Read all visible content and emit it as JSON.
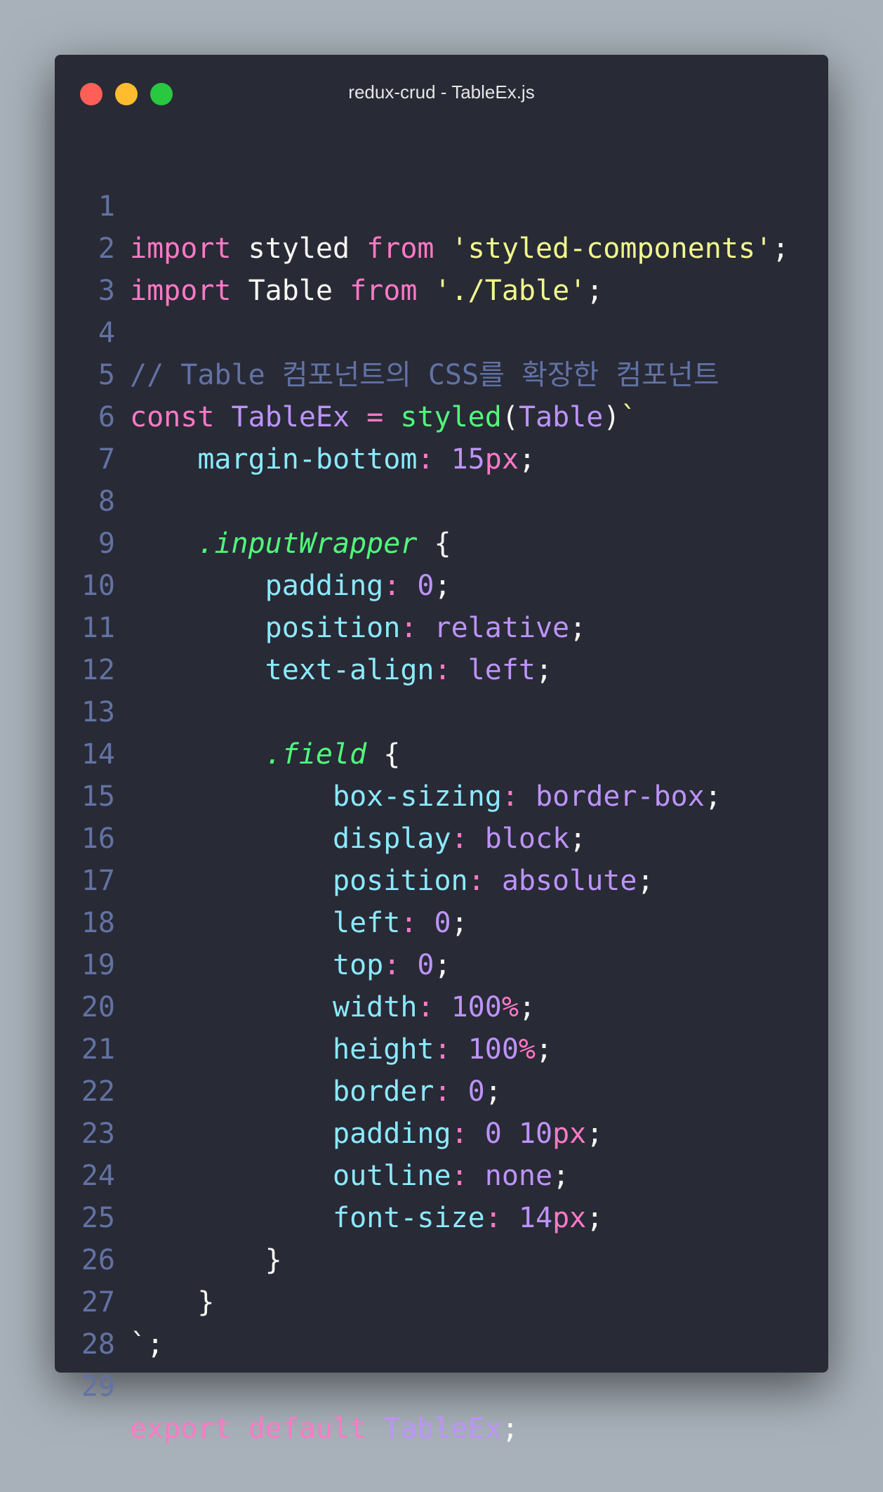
{
  "window": {
    "title": "redux-crud - TableEx.js"
  },
  "colors": {
    "background": "#a8b1ba",
    "editor": "#282a36",
    "close": "#ff5f57",
    "minimize": "#febc2e",
    "maximize": "#28c840",
    "keyword": "#ff79c6",
    "string": "#f1fa8c",
    "comment": "#6272a4",
    "function": "#50fa7b",
    "property": "#8be9fd",
    "value": "#bd93f9"
  },
  "code": {
    "line_numbers": [
      "1",
      "2",
      "3",
      "4",
      "5",
      "6",
      "7",
      "8",
      "9",
      "10",
      "11",
      "12",
      "13",
      "14",
      "15",
      "16",
      "17",
      "18",
      "19",
      "20",
      "21",
      "22",
      "23",
      "24",
      "25",
      "26",
      "27",
      "28",
      "29"
    ],
    "l1": {
      "kw": "import",
      "id": " styled ",
      "from": "from",
      "str": " 'styled-components'",
      "end": ";"
    },
    "l2": {
      "kw": "import",
      "id": " Table ",
      "from": "from",
      "str": " './Table'",
      "end": ";"
    },
    "l4": {
      "comment": "// Table 컴포넌트의 CSS를 확장한 컴포넌트"
    },
    "l5": {
      "kw": "const",
      "name": " TableEx ",
      "eq": "=",
      "fn": " styled",
      "open": "(",
      "arg": "Table",
      "close": ")",
      "tick": "`"
    },
    "l6": {
      "indent": "    ",
      "prop": "margin-bottom",
      "colon": ": ",
      "num": "15",
      "unit": "px",
      "end": ";"
    },
    "l8": {
      "indent": "    ",
      "sel": ".inputWrapper",
      "brace": " {"
    },
    "l9": {
      "indent": "        ",
      "prop": "padding",
      "colon": ": ",
      "val": "0",
      "end": ";"
    },
    "l10": {
      "indent": "        ",
      "prop": "position",
      "colon": ": ",
      "val": "relative",
      "end": ";"
    },
    "l11": {
      "indent": "        ",
      "prop": "text-align",
      "colon": ": ",
      "val": "left",
      "end": ";"
    },
    "l13": {
      "indent": "        ",
      "sel": ".field",
      "brace": " {"
    },
    "l14": {
      "indent": "            ",
      "prop": "box-sizing",
      "colon": ": ",
      "val": "border-box",
      "end": ";"
    },
    "l15": {
      "indent": "            ",
      "prop": "display",
      "colon": ": ",
      "val": "block",
      "end": ";"
    },
    "l16": {
      "indent": "            ",
      "prop": "position",
      "colon": ": ",
      "val": "absolute",
      "end": ";"
    },
    "l17": {
      "indent": "            ",
      "prop": "left",
      "colon": ": ",
      "val": "0",
      "end": ";"
    },
    "l18": {
      "indent": "            ",
      "prop": "top",
      "colon": ": ",
      "val": "0",
      "end": ";"
    },
    "l19": {
      "indent": "            ",
      "prop": "width",
      "colon": ": ",
      "num": "100",
      "unit": "%",
      "end": ";"
    },
    "l20": {
      "indent": "            ",
      "prop": "height",
      "colon": ": ",
      "num": "100",
      "unit": "%",
      "end": ";"
    },
    "l21": {
      "indent": "            ",
      "prop": "border",
      "colon": ": ",
      "val": "0",
      "end": ";"
    },
    "l22": {
      "indent": "            ",
      "prop": "padding",
      "colon": ": ",
      "val": "0 10",
      "unit": "px",
      "end": ";"
    },
    "l23": {
      "indent": "            ",
      "prop": "outline",
      "colon": ": ",
      "val": "none",
      "end": ";"
    },
    "l24": {
      "indent": "            ",
      "prop": "font-size",
      "colon": ": ",
      "num": "14",
      "unit": "px",
      "end": ";"
    },
    "l25": {
      "text": "        }"
    },
    "l26": {
      "text": "    }"
    },
    "l27": {
      "text": "`;"
    },
    "l29": {
      "kw": "export",
      "kw2": " default",
      "name": " TableEx",
      "end": ";"
    }
  }
}
